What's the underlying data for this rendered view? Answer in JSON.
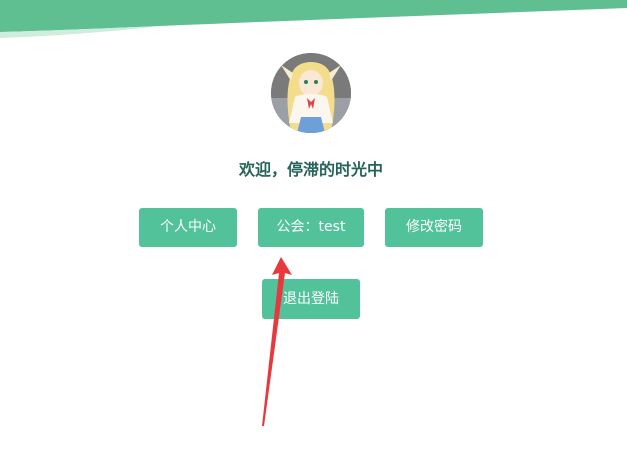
{
  "header": {
    "wave_color": "#5fbf90",
    "wave_light_color": "#cdeedd"
  },
  "user": {
    "welcome_text": "欢迎，停滞的时光中",
    "avatar_desc": "anime-girl-avatar"
  },
  "actions": {
    "profile_label": "个人中心",
    "guild_label": "公会：test",
    "change_password_label": "修改密码",
    "logout_label": "退出登陆"
  },
  "colors": {
    "button_bg": "#52c29a",
    "welcome_text": "#25645a",
    "arrow": "#e8373d"
  }
}
